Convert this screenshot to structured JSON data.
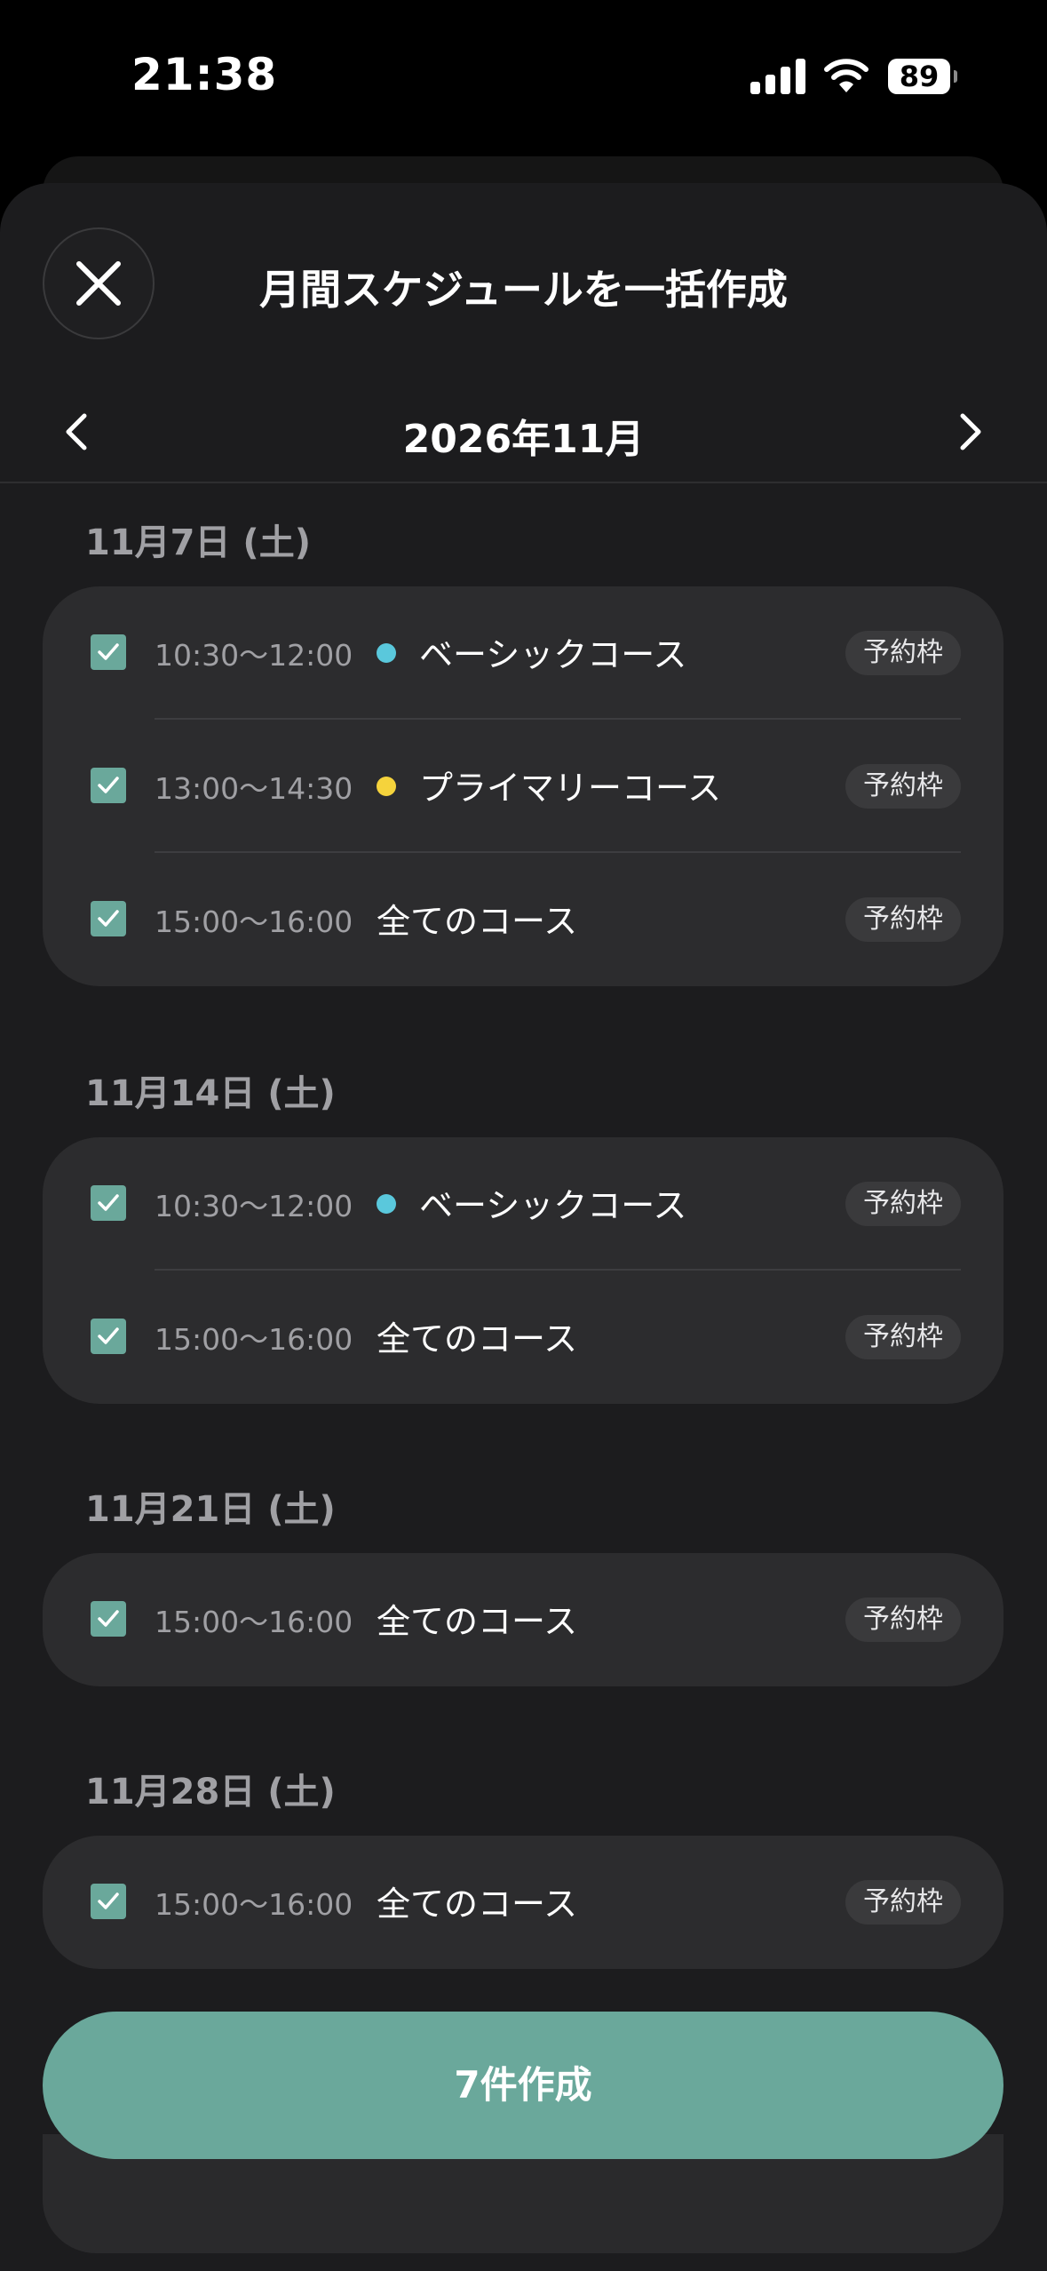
{
  "status_bar": {
    "time": "21:38",
    "battery": "89"
  },
  "sheet": {
    "title": "月間スケジュールを一括作成"
  },
  "month_nav": {
    "label": "2026年11月"
  },
  "days": [
    {
      "date": "11月7日 (土)",
      "slots": [
        {
          "time": "10:30〜12:00",
          "course": "ベーシックコース",
          "dot_color": "#5ac8dc",
          "badge": "予約枠"
        },
        {
          "time": "13:00〜14:30",
          "course": "プライマリーコース",
          "dot_color": "#f5d33c",
          "badge": "予約枠"
        },
        {
          "time": "15:00〜16:00",
          "course": "全てのコース",
          "badge": "予約枠"
        }
      ]
    },
    {
      "date": "11月14日 (土)",
      "slots": [
        {
          "time": "10:30〜12:00",
          "course": "ベーシックコース",
          "dot_color": "#5ac8dc",
          "badge": "予約枠"
        },
        {
          "time": "15:00〜16:00",
          "course": "全てのコース",
          "badge": "予約枠"
        }
      ]
    },
    {
      "date": "11月21日 (土)",
      "slots": [
        {
          "time": "15:00〜16:00",
          "course": "全てのコース",
          "badge": "予約枠"
        }
      ]
    },
    {
      "date": "11月28日 (土)",
      "slots": [
        {
          "time": "15:00〜16:00",
          "course": "全てのコース",
          "badge": "予約枠"
        }
      ]
    }
  ],
  "footer": {
    "create_label": "7件作成"
  },
  "colors": {
    "accent": "#6aa89b",
    "basic_course": "#5ac8dc",
    "primary_course": "#f5d33c"
  }
}
